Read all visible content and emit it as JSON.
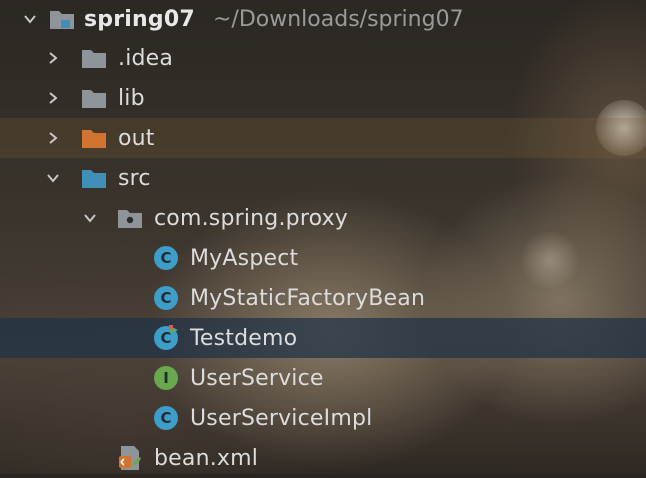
{
  "project": {
    "name": "spring07",
    "path": "~/Downloads/spring07"
  },
  "items": [
    {
      "label": ".idea",
      "icon": "folder-icon"
    },
    {
      "label": "lib",
      "icon": "folder-icon"
    },
    {
      "label": "out",
      "icon": "excluded-folder-icon"
    },
    {
      "label": "src",
      "icon": "source-folder-icon"
    },
    {
      "label": "com.spring.proxy",
      "icon": "package-icon"
    },
    {
      "label": "MyAspect",
      "icon": "class-icon",
      "badge": "C"
    },
    {
      "label": "MyStaticFactoryBean",
      "icon": "class-icon",
      "badge": "C"
    },
    {
      "label": "Testdemo",
      "icon": "runnable-class-icon",
      "badge": "C"
    },
    {
      "label": "UserService",
      "icon": "interface-icon",
      "badge": "I"
    },
    {
      "label": "UserServiceImpl",
      "icon": "class-icon",
      "badge": "C"
    },
    {
      "label": "bean.xml",
      "icon": "spring-xml-icon"
    }
  ],
  "colors": {
    "folder": "#8e9499",
    "excluded_folder": "#d0742f",
    "source_folder": "#3f8fb7",
    "class_badge": "#3d9ec9",
    "interface_badge": "#6aa84f",
    "selection": "#1e3246"
  }
}
